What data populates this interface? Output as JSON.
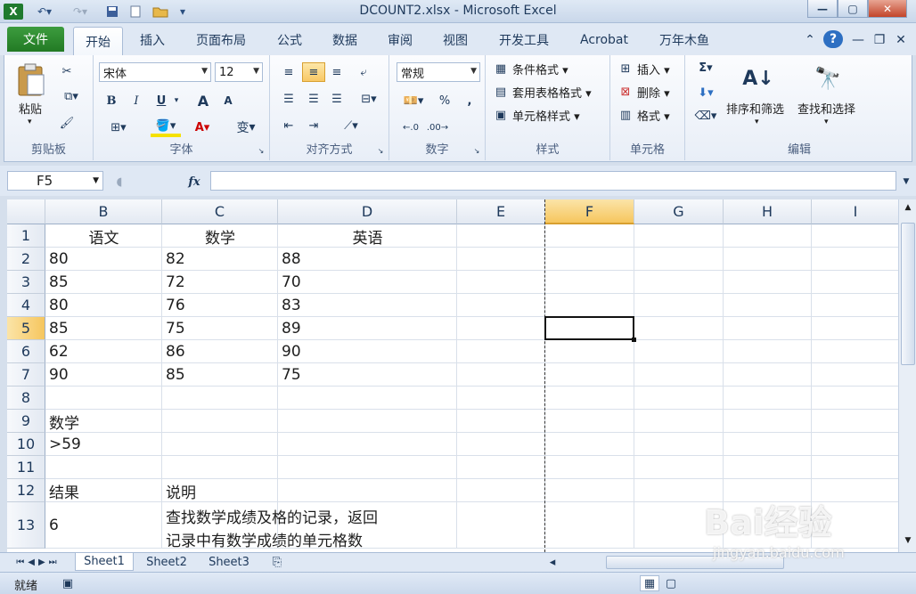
{
  "window": {
    "title": "DCOUNT2.xlsx  -  Microsoft Excel",
    "app_icon": "X"
  },
  "tabs": {
    "file": "文件",
    "items": [
      "开始",
      "插入",
      "页面布局",
      "公式",
      "数据",
      "审阅",
      "视图",
      "开发工具",
      "Acrobat",
      "万年木鱼"
    ],
    "active": "开始"
  },
  "ribbon": {
    "clipboard": {
      "label": "剪贴板",
      "paste": "粘贴"
    },
    "font": {
      "label": "字体",
      "font_name": "宋体",
      "font_size": "12",
      "bold": "B",
      "italic": "I",
      "underline": "U",
      "grow": "A",
      "shrink": "A",
      "phonetic": "变"
    },
    "alignment": {
      "label": "对齐方式"
    },
    "number": {
      "label": "数字",
      "format": "常规",
      "percent": "%",
      "comma": ","
    },
    "styles": {
      "label": "样式",
      "conditional": "条件格式",
      "table": "套用表格格式",
      "cell": "单元格样式"
    },
    "cells": {
      "label": "单元格",
      "insert": "插入",
      "delete": "删除",
      "format": "格式"
    },
    "editing": {
      "label": "编辑",
      "sort": "排序和筛选",
      "find": "查找和选择",
      "sigma": "Σ"
    }
  },
  "formula_bar": {
    "name_box": "F5",
    "fx": "fx",
    "value": ""
  },
  "grid": {
    "columns": [
      "B",
      "C",
      "D",
      "E",
      "F",
      "G",
      "H",
      "I"
    ],
    "selected_column": "F",
    "rows": [
      "1",
      "2",
      "3",
      "4",
      "5",
      "6",
      "7",
      "8",
      "9",
      "10",
      "11",
      "12",
      "13"
    ],
    "selected_row": "5",
    "header_row": [
      "语文",
      "数学",
      "英语"
    ],
    "data": [
      [
        "80",
        "82",
        "88"
      ],
      [
        "85",
        "72",
        "70"
      ],
      [
        "80",
        "76",
        "83"
      ],
      [
        "85",
        "75",
        "89"
      ],
      [
        "62",
        "86",
        "90"
      ],
      [
        "90",
        "85",
        "75"
      ]
    ],
    "criteria_field": "数学",
    "criteria_value": ">59",
    "result_label": "结果",
    "explain_label": "说明",
    "result_value": "6",
    "explain_text_1": "查找数学成绩及格的记录，返回",
    "explain_text_2": "记录中有数学成绩的单元格数"
  },
  "sheets": {
    "items": [
      "Sheet1",
      "Sheet2",
      "Sheet3"
    ],
    "active": "Sheet1"
  },
  "status": {
    "ready": "就绪"
  },
  "watermark": {
    "text": "Bai经验",
    "url": "jingyan.baidu.com"
  },
  "colors": {
    "file_tab": "#2a8a2c",
    "selection": "#f6c65e",
    "accent": "#1e395b"
  }
}
